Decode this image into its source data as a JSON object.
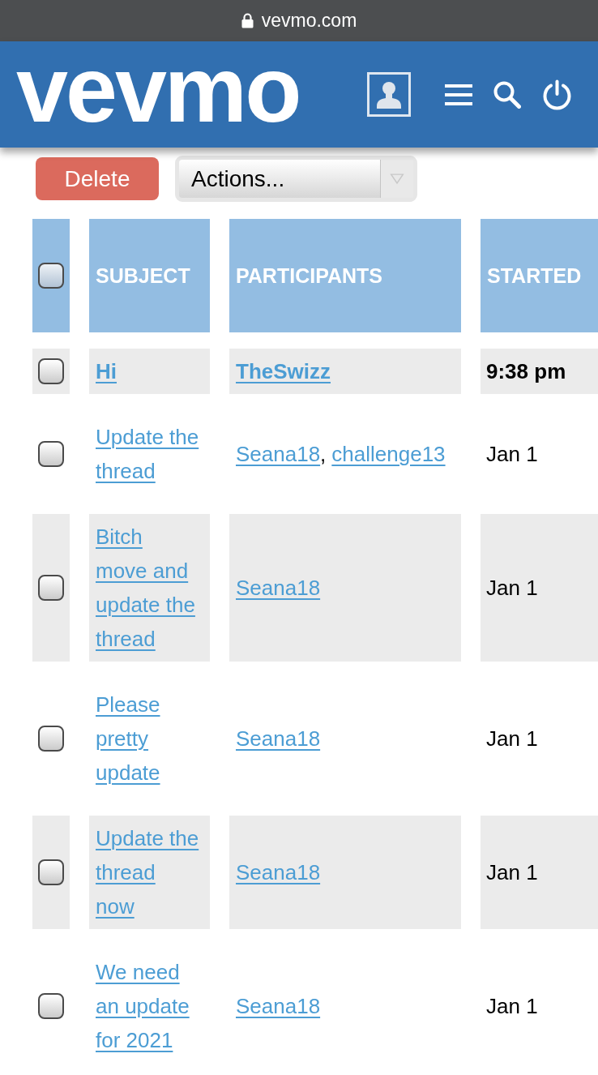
{
  "browser_bar": {
    "url": "vevmo.com"
  },
  "header": {
    "logo": "vevmo"
  },
  "toolbar": {
    "delete_button": "Delete",
    "actions_select": "Actions..."
  },
  "table": {
    "select_all": {
      "checked": false
    },
    "columns": [
      "SUBJECT",
      "PARTICIPANTS",
      "STARTED"
    ],
    "rows": [
      {
        "checked": false,
        "unread": true,
        "subject": "Hi",
        "participants": [
          {
            "name": "TheSwizz"
          }
        ],
        "started": "9:38 pm"
      },
      {
        "checked": false,
        "unread": false,
        "subject": "Update the thread",
        "participants": [
          {
            "name": "Seana18",
            "separator": ","
          },
          {
            "name": "challenge13"
          }
        ],
        "started": "Jan 1"
      },
      {
        "checked": false,
        "unread": false,
        "subject": "Bitch move and update the thread",
        "participants": [
          {
            "name": "Seana18"
          }
        ],
        "started": "Jan 1"
      },
      {
        "checked": false,
        "unread": false,
        "subject": "Please pretty update",
        "participants": [
          {
            "name": "Seana18"
          }
        ],
        "started": "Jan 1"
      },
      {
        "checked": false,
        "unread": false,
        "subject": "Update the thread now",
        "participants": [
          {
            "name": "Seana18"
          }
        ],
        "started": "Jan 1"
      },
      {
        "checked": false,
        "unread": false,
        "subject": "We need an update for 2021",
        "participants": [
          {
            "name": "Seana18"
          }
        ],
        "started": "Jan 1"
      }
    ]
  }
}
